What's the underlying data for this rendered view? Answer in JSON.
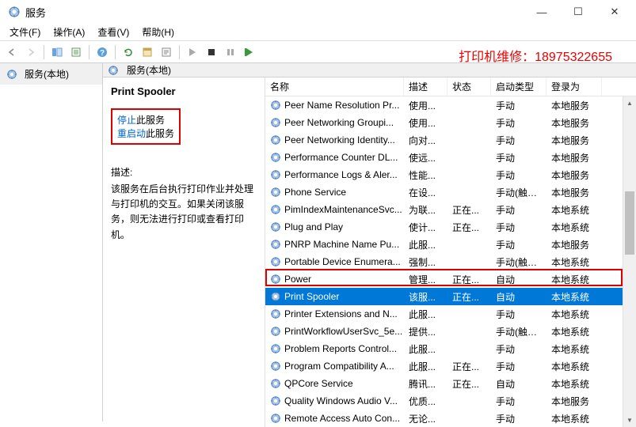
{
  "window": {
    "title": "服务"
  },
  "menus": {
    "file": "文件(F)",
    "action": "操作(A)",
    "view": "查看(V)",
    "help": "帮助(H)"
  },
  "tree": {
    "root": "服务(本地)"
  },
  "right_header": "服务(本地)",
  "detail": {
    "service_name": "Print Spooler",
    "stop_link": "停止",
    "stop_suffix": "此服务",
    "restart_link": "重启动",
    "restart_suffix": "此服务",
    "desc_label": "描述:",
    "desc_text": "该服务在后台执行打印作业并处理与打印机的交互。如果关闭该服务，则无法进行打印或查看打印机。"
  },
  "columns": {
    "name": "名称",
    "desc": "描述",
    "status": "状态",
    "startup": "启动类型",
    "logon": "登录为"
  },
  "services": [
    {
      "name": "Peer Name Resolution Pr...",
      "desc": "使用...",
      "status": "",
      "startup": "手动",
      "logon": "本地服务"
    },
    {
      "name": "Peer Networking Groupi...",
      "desc": "使用...",
      "status": "",
      "startup": "手动",
      "logon": "本地服务"
    },
    {
      "name": "Peer Networking Identity...",
      "desc": "向对...",
      "status": "",
      "startup": "手动",
      "logon": "本地服务"
    },
    {
      "name": "Performance Counter DL...",
      "desc": "使远...",
      "status": "",
      "startup": "手动",
      "logon": "本地服务"
    },
    {
      "name": "Performance Logs & Aler...",
      "desc": "性能...",
      "status": "",
      "startup": "手动",
      "logon": "本地服务"
    },
    {
      "name": "Phone Service",
      "desc": "在设...",
      "status": "",
      "startup": "手动(触发...",
      "logon": "本地服务"
    },
    {
      "name": "PimIndexMaintenanceSvc...",
      "desc": "为联...",
      "status": "正在...",
      "startup": "手动",
      "logon": "本地系统"
    },
    {
      "name": "Plug and Play",
      "desc": "使计...",
      "status": "正在...",
      "startup": "手动",
      "logon": "本地系统"
    },
    {
      "name": "PNRP Machine Name Pu...",
      "desc": "此服...",
      "status": "",
      "startup": "手动",
      "logon": "本地服务"
    },
    {
      "name": "Portable Device Enumera...",
      "desc": "强制...",
      "status": "",
      "startup": "手动(触发...",
      "logon": "本地系统"
    },
    {
      "name": "Power",
      "desc": "管理...",
      "status": "正在...",
      "startup": "自动",
      "logon": "本地系统"
    },
    {
      "name": "Print Spooler",
      "desc": "该服...",
      "status": "正在...",
      "startup": "自动",
      "logon": "本地系统",
      "selected": true
    },
    {
      "name": "Printer Extensions and N...",
      "desc": "此服...",
      "status": "",
      "startup": "手动",
      "logon": "本地系统"
    },
    {
      "name": "PrintWorkflowUserSvc_5e...",
      "desc": "提供...",
      "status": "",
      "startup": "手动(触发...",
      "logon": "本地系统"
    },
    {
      "name": "Problem Reports Control...",
      "desc": "此服...",
      "status": "",
      "startup": "手动",
      "logon": "本地系统"
    },
    {
      "name": "Program Compatibility A...",
      "desc": "此服...",
      "status": "正在...",
      "startup": "手动",
      "logon": "本地系统"
    },
    {
      "name": "QPCore Service",
      "desc": "腾讯...",
      "status": "正在...",
      "startup": "自动",
      "logon": "本地系统"
    },
    {
      "name": "Quality Windows Audio V...",
      "desc": "优质...",
      "status": "",
      "startup": "手动",
      "logon": "本地服务"
    },
    {
      "name": "Remote Access Auto Con...",
      "desc": "无论...",
      "status": "",
      "startup": "手动",
      "logon": "本地系统"
    }
  ],
  "annotation": "打印机维修：18975322655"
}
